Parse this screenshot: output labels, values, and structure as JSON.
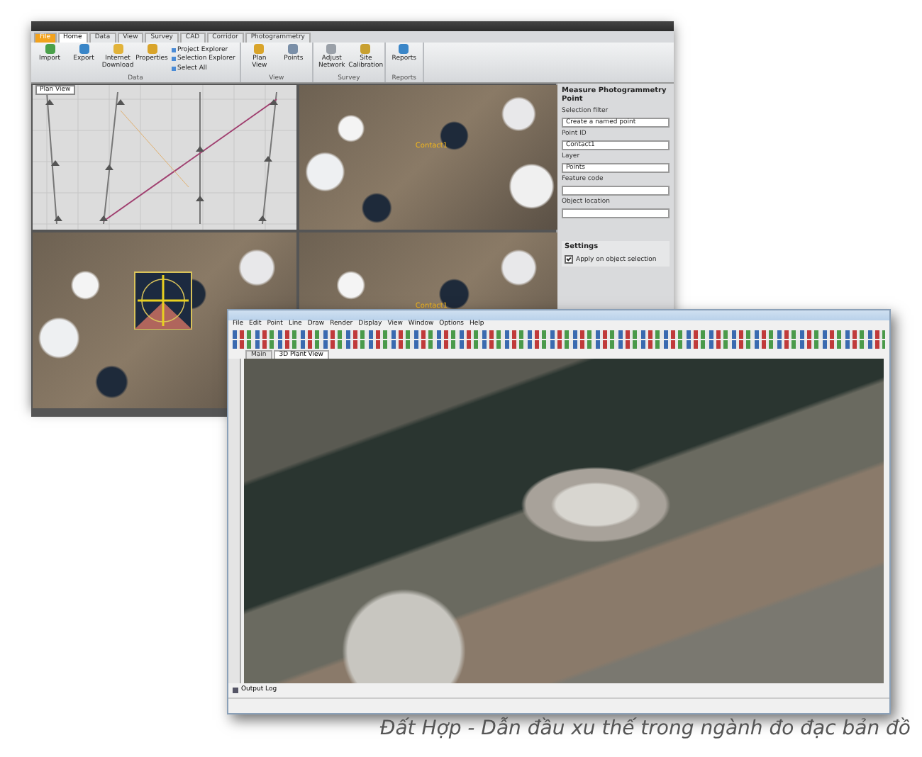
{
  "window_1": {
    "ribbon_tabs": [
      {
        "label": "File",
        "selected": false
      },
      {
        "label": "Home",
        "selected": true
      },
      {
        "label": "Data",
        "selected": false
      },
      {
        "label": "View",
        "selected": false
      },
      {
        "label": "Survey",
        "selected": false
      },
      {
        "label": "CAD",
        "selected": false
      },
      {
        "label": "Corridor",
        "selected": false
      },
      {
        "label": "Photogrammetry",
        "selected": false
      }
    ],
    "ribbon_groups": [
      {
        "name": "Data",
        "buttons": [
          {
            "label": "Import",
            "disabled": false
          },
          {
            "label": "Export",
            "disabled": false
          },
          {
            "label": "Internet Download",
            "disabled": false
          },
          {
            "label": "Properties",
            "disabled": false
          }
        ],
        "small_buttons": [
          "Project Explorer",
          "Selection Explorer",
          "Select All"
        ]
      },
      {
        "name": "View",
        "buttons": [
          {
            "label": "Plan View",
            "disabled": false
          },
          {
            "label": "Points",
            "disabled": false
          }
        ]
      },
      {
        "name": "Survey",
        "buttons": [
          {
            "label": "Adjust Network",
            "disabled": false
          },
          {
            "label": "Site Calibration",
            "disabled": false
          }
        ]
      },
      {
        "name": "Reports",
        "buttons": [
          {
            "label": "Reports",
            "disabled": false
          }
        ]
      }
    ],
    "views": [
      {
        "kind": "plan",
        "tab": "Plan View"
      },
      {
        "kind": "photo",
        "point": "Contact1"
      },
      {
        "kind": "target"
      },
      {
        "kind": "photo",
        "point": "Contact1"
      }
    ],
    "side_panel": {
      "title": "Measure Photogrammetry Point",
      "fields": [
        {
          "label": "Selection filter",
          "value": "Create a named point"
        },
        {
          "label": "Point ID",
          "value": "Contact1"
        },
        {
          "label": "Layer",
          "value": "Points"
        },
        {
          "label": "Feature code"
        },
        {
          "label": "Object location"
        }
      ],
      "settings_title": "Settings",
      "settings": [
        {
          "label": "Apply on object selection",
          "checked": true
        }
      ]
    }
  },
  "window_2": {
    "menu": [
      "File",
      "Edit",
      "Point",
      "Line",
      "Draw",
      "Render",
      "Display",
      "View",
      "Window",
      "Options",
      "Help"
    ],
    "tabs": [
      {
        "label": "Main",
        "selected": false
      },
      {
        "label": "3D Plant View",
        "selected": true
      }
    ],
    "output_label": "Output Log"
  },
  "caption": "Đất Hợp - Dẫn đầu xu thế trong ngành đo đạc bản đồ"
}
